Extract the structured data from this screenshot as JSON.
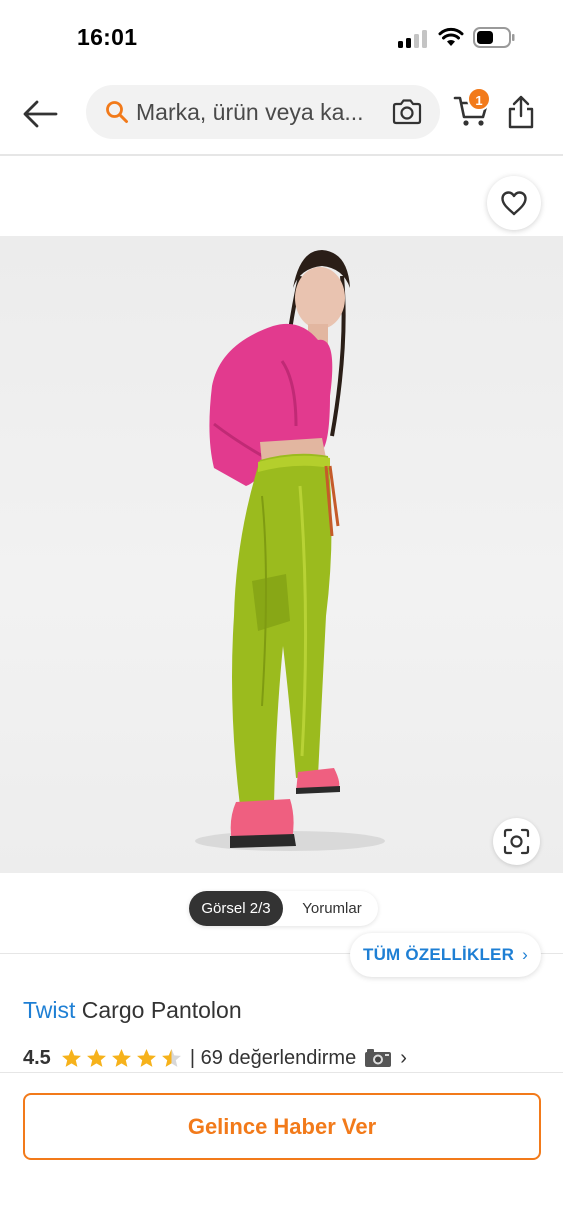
{
  "status_bar": {
    "time": "16:01"
  },
  "header": {
    "search": {
      "placeholder": "Marka, ürün veya ka..."
    },
    "cart": {
      "badge_count": "1"
    }
  },
  "product": {
    "gallery": {
      "tab_image_label": "Görsel 2/3",
      "tab_reviews_label": "Yorumlar"
    },
    "all_features_label": "TÜM ÖZELLİKLER",
    "brand": "Twist",
    "name": "Cargo Pantolon",
    "rating": {
      "value": "4.5",
      "stars": 4.5,
      "max_stars": 5,
      "review_count_text": "| 69 değerlendirme"
    },
    "cta_label": "Gelince Haber Ver"
  },
  "colors": {
    "accent_orange": "#f27a1a",
    "link_blue": "#1e7fd4",
    "star_yellow": "#f6b21b",
    "shirt_pink": "#e23a8e",
    "pants_green": "#9bbb1e",
    "sandal_pink": "#ef5f80"
  }
}
